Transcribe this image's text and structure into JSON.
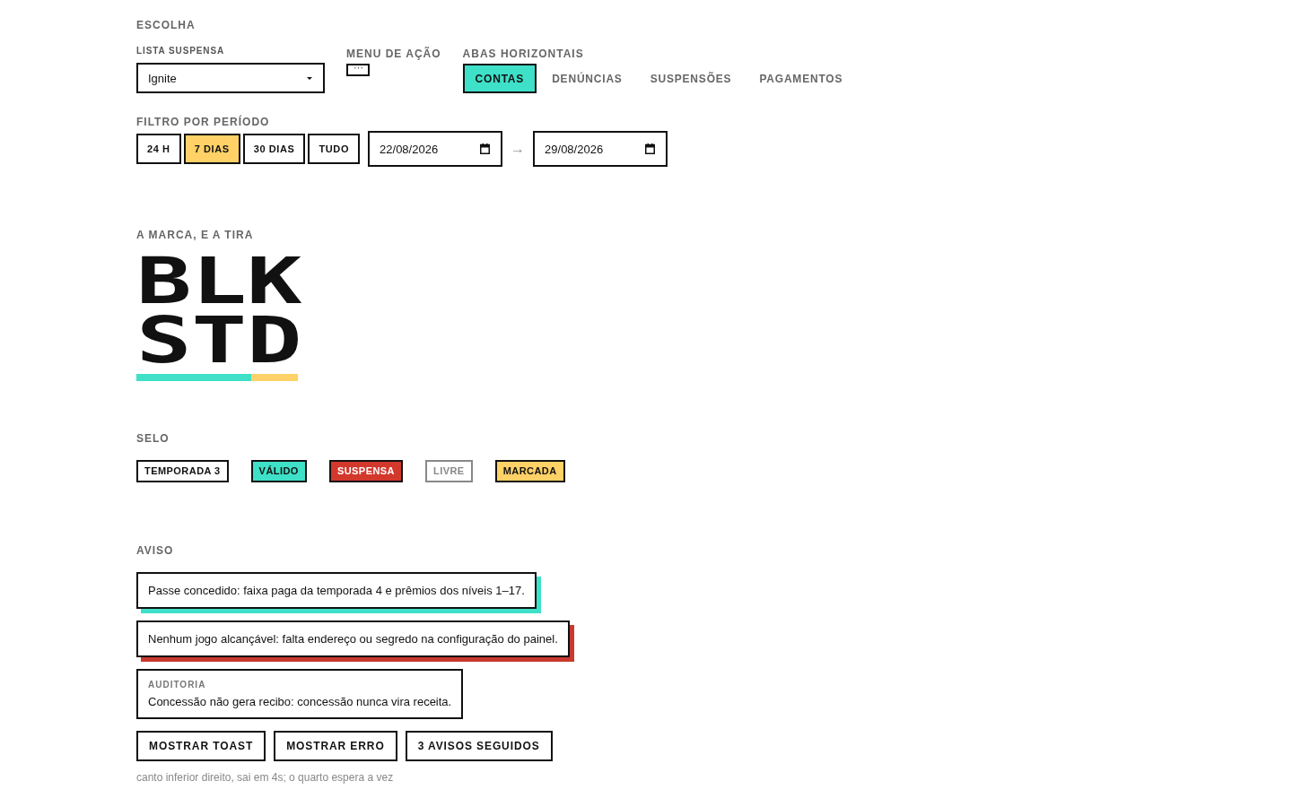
{
  "choice": {
    "title": "ESCOLHA",
    "dropdown": {
      "label": "LISTA SUSPENSA",
      "value": "Ignite"
    },
    "action_menu": {
      "label": "MENU DE AÇÃO"
    },
    "tabs": {
      "label": "ABAS HORIZONTAIS",
      "items": [
        {
          "label": "CONTAS",
          "selected": true
        },
        {
          "label": "DENÚNCIAS",
          "selected": false
        },
        {
          "label": "SUSPENSÕES",
          "selected": false
        },
        {
          "label": "PAGAMENTOS",
          "selected": false
        }
      ]
    }
  },
  "period_filter": {
    "title": "FILTRO POR PERÍODO",
    "presets": [
      {
        "label": "24 H",
        "selected": false
      },
      {
        "label": "7 DIAS",
        "selected": true
      },
      {
        "label": "30 DIAS",
        "selected": false
      },
      {
        "label": "TUDO",
        "selected": false
      }
    ],
    "date_from": "22/08/2026",
    "separator": "→",
    "date_to": "29/08/2026"
  },
  "brand": {
    "title": "A MARCA, E A TIRA",
    "wordmark": [
      "BLK",
      "STD"
    ]
  },
  "badges": {
    "title": "SELO",
    "items": [
      {
        "label": "TEMPORADA 3",
        "kind": "neutral"
      },
      {
        "label": "VÁLIDO",
        "kind": "success"
      },
      {
        "label": "SUSPENSA",
        "kind": "danger"
      },
      {
        "label": "LIVRE",
        "kind": "muted"
      },
      {
        "label": "MARCADA",
        "kind": "warning"
      }
    ]
  },
  "notices": {
    "title": "AVISO",
    "items": [
      {
        "kind": "success",
        "text": "Passe concedido: faixa paga da temporada 4 e prêmios dos níveis 1–17."
      },
      {
        "kind": "error",
        "text": "Nenhum jogo alcançável: falta endereço ou segredo na configuração do painel."
      },
      {
        "kind": "info",
        "label": "AUDITORIA",
        "text": "Concessão não gera recibo: concessão nunca vira receita."
      }
    ],
    "buttons": [
      "MOSTRAR TOAST",
      "MOSTRAR ERRO",
      "3 AVISOS SEGUIDOS"
    ],
    "hint": "canto inferior direito, sai em 4s; o quarto espera a vez"
  }
}
